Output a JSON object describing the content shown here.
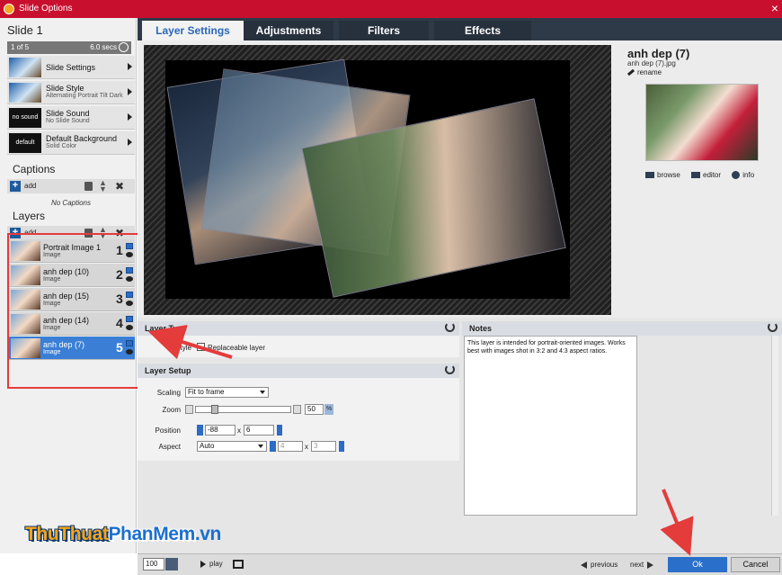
{
  "window": {
    "title": "Slide Options",
    "close": "×"
  },
  "left": {
    "slide_title": "Slide 1",
    "slide_count": "1 of 5",
    "slide_duration": "6.0 secs",
    "options": [
      {
        "name": "Slide Settings",
        "sub": "",
        "thumb": ""
      },
      {
        "name": "Slide Style",
        "sub": "Alternating Portrait Tilt Dark",
        "thumb": ""
      },
      {
        "name": "Slide Sound",
        "sub": "No Slide Sound",
        "thumb": "no sound"
      },
      {
        "name": "Default Background",
        "sub": "Solid Color",
        "thumb": "default"
      }
    ],
    "captions_title": "Captions",
    "add_label": "add",
    "no_captions": "No Captions",
    "layers_title": "Layers",
    "layers_add_label": "add",
    "layers": [
      {
        "name": "Portrait Image 1",
        "type": "Image",
        "num": "1"
      },
      {
        "name": "anh dep (10)",
        "type": "Image",
        "num": "2"
      },
      {
        "name": "anh dep (15)",
        "type": "Image",
        "num": "3"
      },
      {
        "name": "anh dep (14)",
        "type": "Image",
        "num": "4"
      },
      {
        "name": "anh dep (7)",
        "type": "Image",
        "num": "5"
      }
    ]
  },
  "tabs": [
    "Layer Settings",
    "Adjustments",
    "Filters",
    "Effects"
  ],
  "file": {
    "title": "anh dep (7)",
    "filename": "anh dep (7).jpg",
    "rename": "rename",
    "browse": "browse",
    "editor": "editor",
    "info": "info"
  },
  "layer_type": {
    "title": "Layer Type",
    "style_label": "Style",
    "checkbox_label": "Replaceable layer"
  },
  "layer_setup": {
    "title": "Layer Setup",
    "scaling_label": "Scaling",
    "scaling_value": "Fit to frame",
    "zoom_label": "Zoom",
    "zoom_value": "50",
    "zoom_unit": "%",
    "position_label": "Position",
    "pos_x": "-88",
    "pos_sep": "x",
    "pos_y": "6",
    "aspect_label": "Aspect",
    "aspect_value": "Auto",
    "aspect_w": "4",
    "aspect_sep": "x",
    "aspect_h": "3"
  },
  "notes": {
    "title": "Notes",
    "text": "This layer is intended for portrait-oriented images. Works best with images shot in 3:2 and 4:3 aspect ratios."
  },
  "bottom": {
    "zoom": "100",
    "play": "play",
    "previous": "previous",
    "next": "next",
    "ok": "Ok",
    "cancel": "Cancel"
  },
  "watermark": {
    "part1": "ThuThuat",
    "part2": "PhanMem",
    "part3": ".vn"
  },
  "colors": {
    "titlebar": "#c8102e",
    "tab_active_text": "#2a67b8",
    "selected_layer": "#3a7fd5",
    "ok_button": "#2a6fc9",
    "annotation_red": "#e43b3b"
  }
}
